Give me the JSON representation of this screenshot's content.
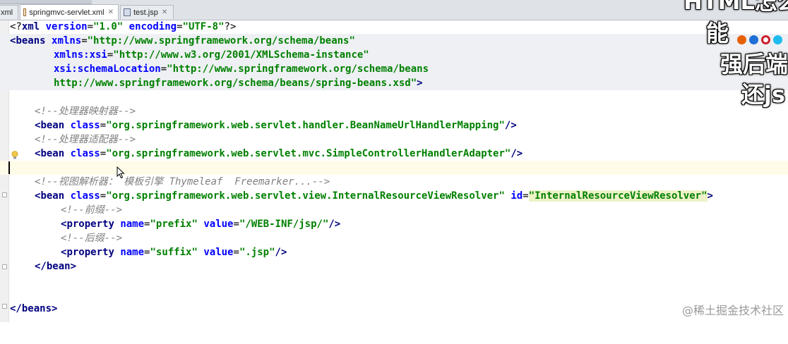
{
  "tabs": [
    {
      "label": "xml",
      "icon": "xml-file-icon"
    },
    {
      "label": "springmvc-servlet.xml",
      "icon": "xml-file-icon",
      "active": true
    },
    {
      "label": "test.jsp",
      "icon": "jsp-file-icon"
    }
  ],
  "code": {
    "decl": {
      "open": "<?",
      "name": "xml",
      "a1": "version",
      "v1": "\"1.0\"",
      "a2": "encoding",
      "v2": "\"UTF-8\"",
      "close": "?>"
    },
    "beans_open": {
      "lt": "<",
      "tag": "beans",
      "a": "xmlns",
      "eq": "=",
      "v": "\"http://www.springframework.org/schema/beans\""
    },
    "xmlns_xsi": {
      "a": "xmlns:xsi",
      "eq": "=",
      "v": "\"http://www.w3.org/2001/XMLSchema-instance\""
    },
    "schema_loc": {
      "a": "xsi:schemaLocation",
      "eq": "=",
      "v": "\"http://www.springframework.org/schema/beans"
    },
    "schema_loc2": {
      "v": "http://www.springframework.org/schema/beans/spring-beans.xsd\"",
      "gt": ">"
    },
    "c1": "<!--处理器映射器-->",
    "bean1": {
      "lt": "<",
      "tag": "bean",
      "a": "class",
      "eq": "=",
      "v": "\"org.springframework.web.servlet.handler.BeanNameUrlHandlerMapping\"",
      "end": "/>"
    },
    "c2": "<!--处理器适配器-->",
    "bean2": {
      "lt": "<",
      "tag": "bean",
      "a": "class",
      "eq": "=",
      "v": "\"org.springframework.web.servlet.mvc.SimpleControllerHandlerAdapter\"",
      "end": "/>"
    },
    "c3": "<!--视图解析器： 模板引擎 Thymeleaf  Freemarker...-->",
    "bean3": {
      "lt": "<",
      "tag": "bean",
      "a": "class",
      "eq": "=",
      "v": "\"org.springframework.web.servlet.view.InternalResourceViewResolver\"",
      "a2": "id",
      "v2": "\"InternalResourceViewResolver\"",
      "gt": ">"
    },
    "c4": "<!--前缀-->",
    "prop1": {
      "lt": "<",
      "tag": "property",
      "a1": "name",
      "v1": "\"prefix\"",
      "a2": "value",
      "v2": "\"/WEB-INF/jsp/\"",
      "end": "/>"
    },
    "c5": "<!--后缀-->",
    "prop2": {
      "lt": "<",
      "tag": "property",
      "a1": "name",
      "v1": "\"suffix\"",
      "a2": "value",
      "v2": "\".jsp\"",
      "end": "/>"
    },
    "bean_close": {
      "lt": "</",
      "tag": "bean",
      "gt": ">"
    },
    "beans_close": {
      "lt": "</",
      "tag": "beans",
      "gt": ">"
    }
  },
  "overlay": {
    "line1": "HTML怎么",
    "line2": "能",
    "line3": "强后端",
    "line4": "还js"
  },
  "watermark": "@稀土掘金技术社区",
  "colors": {
    "tag": "#000080",
    "attr": "#0000ff",
    "value": "#008000",
    "comment": "#808080"
  }
}
